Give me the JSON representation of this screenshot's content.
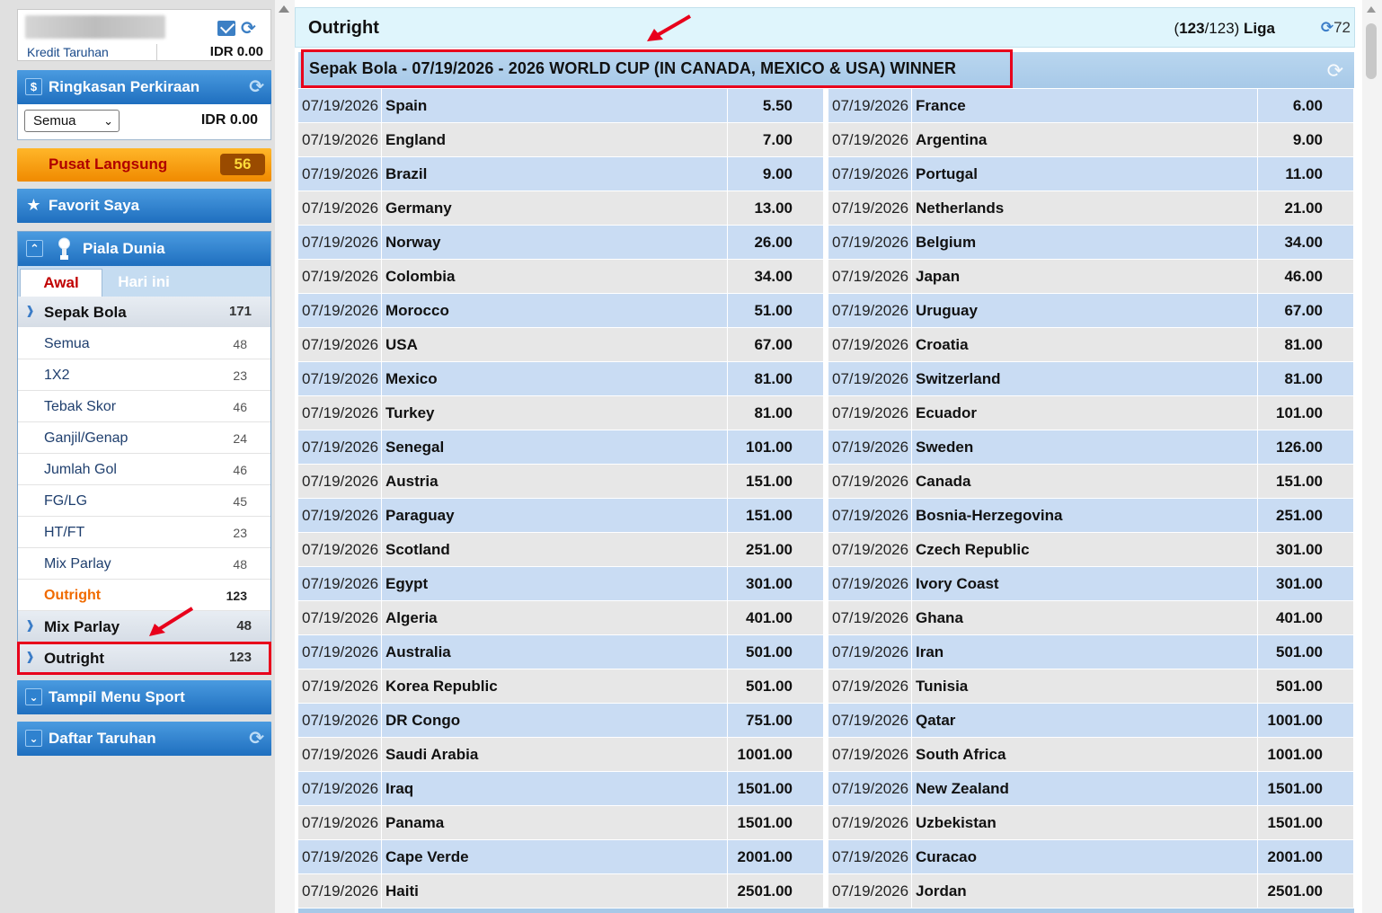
{
  "account": {
    "credit_label": "Kredit Taruhan",
    "credit_value": "IDR  0.00"
  },
  "summary": {
    "title": "Ringkasan Perkiraan",
    "select_value": "Semua",
    "amount": "IDR 0.00"
  },
  "live_center": {
    "label": "Pusat Langsung",
    "count": "56"
  },
  "favorites": {
    "label": "Favorit Saya"
  },
  "world_cup": {
    "title": "Piala Dunia",
    "tabs": [
      {
        "label": "Awal"
      },
      {
        "label": "Hari ini"
      }
    ],
    "sport": {
      "label": "Sepak Bola",
      "count": "171"
    },
    "sub_items": [
      {
        "label": "Semua",
        "count": "48"
      },
      {
        "label": "1X2",
        "count": "23"
      },
      {
        "label": "Tebak Skor",
        "count": "46"
      },
      {
        "label": "Ganjil/Genap",
        "count": "24"
      },
      {
        "label": "Jumlah Gol",
        "count": "46"
      },
      {
        "label": "FG/LG",
        "count": "45"
      },
      {
        "label": "HT/FT",
        "count": "23"
      },
      {
        "label": "Mix Parlay",
        "count": "48"
      },
      {
        "label": "Outright",
        "count": "123"
      }
    ],
    "mix_parlay": {
      "label": "Mix Parlay",
      "count": "48"
    },
    "outright": {
      "label": "Outright",
      "count": "123"
    }
  },
  "sport_menu": {
    "label": "Tampil Menu Sport"
  },
  "bet_list": {
    "label": "Daftar Taruhan"
  },
  "main": {
    "title": "Outright",
    "liga_open": "(",
    "liga_count": "123",
    "liga_total": "/123)",
    "liga_label": "Liga",
    "refresh_count": "72",
    "league_title": "Sepak Bola - 07/19/2026 - 2026 WORLD CUP (IN CANADA, MEXICO & USA) WINNER"
  },
  "rows": [
    {
      "l_date": "07/19/2026",
      "l_team": "Spain",
      "l_odds": "5.50",
      "r_date": "07/19/2026",
      "r_team": "France",
      "r_odds": "6.00"
    },
    {
      "l_date": "07/19/2026",
      "l_team": "England",
      "l_odds": "7.00",
      "r_date": "07/19/2026",
      "r_team": "Argentina",
      "r_odds": "9.00"
    },
    {
      "l_date": "07/19/2026",
      "l_team": "Brazil",
      "l_odds": "9.00",
      "r_date": "07/19/2026",
      "r_team": "Portugal",
      "r_odds": "11.00"
    },
    {
      "l_date": "07/19/2026",
      "l_team": "Germany",
      "l_odds": "13.00",
      "r_date": "07/19/2026",
      "r_team": "Netherlands",
      "r_odds": "21.00"
    },
    {
      "l_date": "07/19/2026",
      "l_team": "Norway",
      "l_odds": "26.00",
      "r_date": "07/19/2026",
      "r_team": "Belgium",
      "r_odds": "34.00"
    },
    {
      "l_date": "07/19/2026",
      "l_team": "Colombia",
      "l_odds": "34.00",
      "r_date": "07/19/2026",
      "r_team": "Japan",
      "r_odds": "46.00"
    },
    {
      "l_date": "07/19/2026",
      "l_team": "Morocco",
      "l_odds": "51.00",
      "r_date": "07/19/2026",
      "r_team": "Uruguay",
      "r_odds": "67.00"
    },
    {
      "l_date": "07/19/2026",
      "l_team": "USA",
      "l_odds": "67.00",
      "r_date": "07/19/2026",
      "r_team": "Croatia",
      "r_odds": "81.00"
    },
    {
      "l_date": "07/19/2026",
      "l_team": "Mexico",
      "l_odds": "81.00",
      "r_date": "07/19/2026",
      "r_team": "Switzerland",
      "r_odds": "81.00"
    },
    {
      "l_date": "07/19/2026",
      "l_team": "Turkey",
      "l_odds": "81.00",
      "r_date": "07/19/2026",
      "r_team": "Ecuador",
      "r_odds": "101.00"
    },
    {
      "l_date": "07/19/2026",
      "l_team": "Senegal",
      "l_odds": "101.00",
      "r_date": "07/19/2026",
      "r_team": "Sweden",
      "r_odds": "126.00"
    },
    {
      "l_date": "07/19/2026",
      "l_team": "Austria",
      "l_odds": "151.00",
      "r_date": "07/19/2026",
      "r_team": "Canada",
      "r_odds": "151.00"
    },
    {
      "l_date": "07/19/2026",
      "l_team": "Paraguay",
      "l_odds": "151.00",
      "r_date": "07/19/2026",
      "r_team": "Bosnia-Herzegovina",
      "r_odds": "251.00"
    },
    {
      "l_date": "07/19/2026",
      "l_team": "Scotland",
      "l_odds": "251.00",
      "r_date": "07/19/2026",
      "r_team": "Czech Republic",
      "r_odds": "301.00"
    },
    {
      "l_date": "07/19/2026",
      "l_team": "Egypt",
      "l_odds": "301.00",
      "r_date": "07/19/2026",
      "r_team": "Ivory Coast",
      "r_odds": "301.00"
    },
    {
      "l_date": "07/19/2026",
      "l_team": "Algeria",
      "l_odds": "401.00",
      "r_date": "07/19/2026",
      "r_team": "Ghana",
      "r_odds": "401.00"
    },
    {
      "l_date": "07/19/2026",
      "l_team": "Australia",
      "l_odds": "501.00",
      "r_date": "07/19/2026",
      "r_team": "Iran",
      "r_odds": "501.00"
    },
    {
      "l_date": "07/19/2026",
      "l_team": "Korea Republic",
      "l_odds": "501.00",
      "r_date": "07/19/2026",
      "r_team": "Tunisia",
      "r_odds": "501.00"
    },
    {
      "l_date": "07/19/2026",
      "l_team": "DR Congo",
      "l_odds": "751.00",
      "r_date": "07/19/2026",
      "r_team": "Qatar",
      "r_odds": "1001.00"
    },
    {
      "l_date": "07/19/2026",
      "l_team": "Saudi Arabia",
      "l_odds": "1001.00",
      "r_date": "07/19/2026",
      "r_team": "South Africa",
      "r_odds": "1001.00"
    },
    {
      "l_date": "07/19/2026",
      "l_team": "Iraq",
      "l_odds": "1501.00",
      "r_date": "07/19/2026",
      "r_team": "New Zealand",
      "r_odds": "1501.00"
    },
    {
      "l_date": "07/19/2026",
      "l_team": "Panama",
      "l_odds": "1501.00",
      "r_date": "07/19/2026",
      "r_team": "Uzbekistan",
      "r_odds": "1501.00"
    },
    {
      "l_date": "07/19/2026",
      "l_team": "Cape Verde",
      "l_odds": "2001.00",
      "r_date": "07/19/2026",
      "r_team": "Curacao",
      "r_odds": "2001.00"
    },
    {
      "l_date": "07/19/2026",
      "l_team": "Haiti",
      "l_odds": "2501.00",
      "r_date": "07/19/2026",
      "r_team": "Jordan",
      "r_odds": "2501.00"
    }
  ],
  "colors": {
    "accent_blue": "#1f6fbf",
    "highlight_red": "#e8001b",
    "active_orange": "#f06a00",
    "row_blue": "#c9dcf3",
    "row_gray": "#e7e7e7"
  }
}
